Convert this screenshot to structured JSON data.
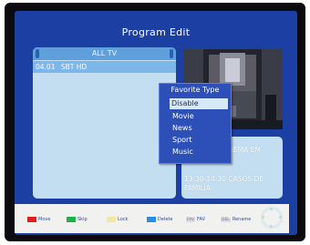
{
  "screen": {
    "title": "Program Edit"
  },
  "channel_list": {
    "header": "ALL TV",
    "rows": [
      {
        "number": "04.01",
        "name": "SBT HD"
      }
    ]
  },
  "program_info": {
    "now": "CINEMA EM",
    "next_time": "13:30-14:30",
    "next_title": "CASOS DE",
    "next_title_cont": "FAMILIA"
  },
  "favorite_menu": {
    "title": "Favorite Type",
    "options": [
      "Disable",
      "Movie",
      "News",
      "Sport",
      "Music"
    ],
    "selected": "Disable"
  },
  "footer": {
    "keys": [
      {
        "color": "#e02020",
        "label": "Move"
      },
      {
        "color": "#1db24b",
        "label": "Skip"
      },
      {
        "color": "#f3e6a0",
        "label": "Lock"
      },
      {
        "color": "#2b8ee6",
        "label": "Delete"
      }
    ],
    "tag_keys": [
      {
        "tag": "FAV",
        "label": "FAV"
      },
      {
        "tag": "DEL",
        "label": "Rename"
      }
    ]
  }
}
